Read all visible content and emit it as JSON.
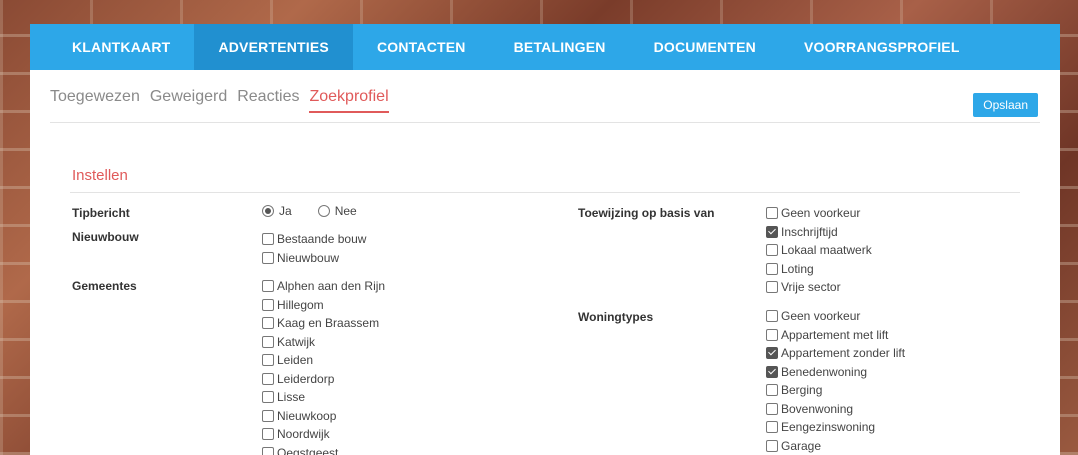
{
  "nav": {
    "items": [
      "KLANTKAART",
      "ADVERTENTIES",
      "CONTACTEN",
      "BETALINGEN",
      "DOCUMENTEN",
      "VOORRANGSPROFIEL"
    ],
    "active_index": 1
  },
  "subnav": {
    "tabs": [
      "Toegewezen",
      "Geweigerd",
      "Reacties",
      "Zoekprofiel"
    ],
    "active_index": 3
  },
  "toolbar": {
    "save_label": "Opslaan"
  },
  "section": {
    "title": "Instellen"
  },
  "tipbericht": {
    "label": "Tipbericht",
    "options": [
      {
        "label": "Ja",
        "selected": true
      },
      {
        "label": "Nee",
        "selected": false
      }
    ]
  },
  "nieuwbouw": {
    "label": "Nieuwbouw",
    "options": [
      {
        "label": "Bestaande bouw",
        "checked": false
      },
      {
        "label": "Nieuwbouw",
        "checked": false
      }
    ]
  },
  "gemeentes": {
    "label": "Gemeentes",
    "options": [
      {
        "label": "Alphen aan den Rijn",
        "checked": false
      },
      {
        "label": "Hillegom",
        "checked": false
      },
      {
        "label": "Kaag en Braassem",
        "checked": false
      },
      {
        "label": "Katwijk",
        "checked": false
      },
      {
        "label": "Leiden",
        "checked": false
      },
      {
        "label": "Leiderdorp",
        "checked": false
      },
      {
        "label": "Lisse",
        "checked": false
      },
      {
        "label": "Nieuwkoop",
        "checked": false
      },
      {
        "label": "Noordwijk",
        "checked": false
      },
      {
        "label": "Oegstgeest",
        "checked": false
      }
    ]
  },
  "toewijzing": {
    "label": "Toewijzing op basis van",
    "options": [
      {
        "label": "Geen voorkeur",
        "checked": false
      },
      {
        "label": "Inschrijftijd",
        "checked": true
      },
      {
        "label": "Lokaal maatwerk",
        "checked": false
      },
      {
        "label": "Loting",
        "checked": false
      },
      {
        "label": "Vrije sector",
        "checked": false
      }
    ]
  },
  "woningtypes": {
    "label": "Woningtypes",
    "options": [
      {
        "label": "Geen voorkeur",
        "checked": false
      },
      {
        "label": "Appartement met lift",
        "checked": false
      },
      {
        "label": "Appartement zonder lift",
        "checked": true
      },
      {
        "label": "Benedenwoning",
        "checked": true
      },
      {
        "label": "Berging",
        "checked": false
      },
      {
        "label": "Bovenwoning",
        "checked": false
      },
      {
        "label": "Eengezinswoning",
        "checked": false
      },
      {
        "label": "Garage",
        "checked": false
      }
    ]
  },
  "colors": {
    "accent": "#2da7e8",
    "active_nav": "#2190d0",
    "highlight": "#e05a5a"
  }
}
